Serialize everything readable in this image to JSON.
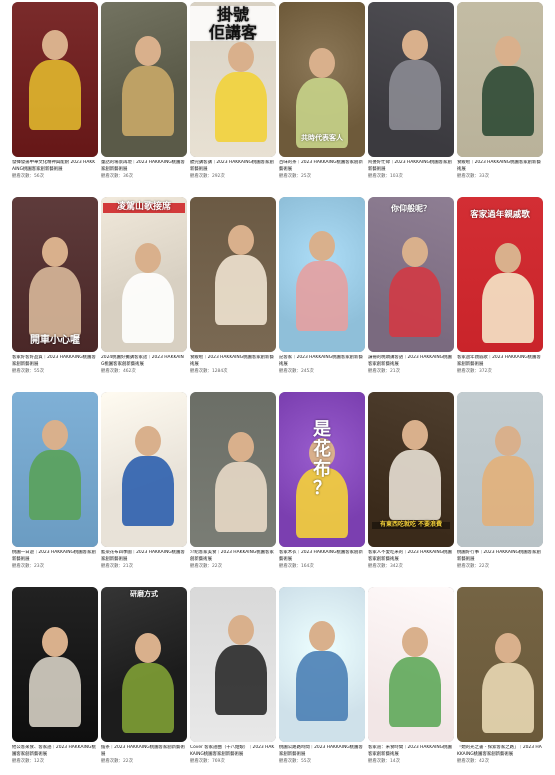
{
  "views_prefix": "觀看次數：",
  "views_suffix": "次",
  "videos": [
    {
      "title": "發揮發揚中華文化精神與能耐 2023 HAKKAING桃園客家創新藝術展",
      "views": "56",
      "overlay": "",
      "bg": "#7a2b2b",
      "accent": "#e0b72d"
    },
    {
      "title": "童話的場景再現｜2023 HAKKAING桃園客家創新藝術展",
      "views": "36",
      "overlay": "",
      "bg": "#5a5a48",
      "accent": "#c9a868"
    },
    {
      "title": "聽完講客講｜2023 HAKKAING桃園客家創新藝術展",
      "views": "292",
      "overlay": "掛號\n佢講客",
      "bg": "#d9d2c4",
      "accent": "#f2d23a"
    },
    {
      "title": "百味的茶｜2023 HAKKAING桃園客家創新藝術展",
      "views": "25",
      "overlay": "共時代表客人",
      "bg": "#6e5a3a",
      "accent": "#c8d48a"
    },
    {
      "title": "阿婆好忙碌｜2023 HAKKAING桃園客家創新藝術展",
      "views": "103",
      "overlay": "",
      "bg": "#3b3a3f",
      "accent": "#8b8b92"
    },
    {
      "title": "食飯啦｜2023 HAKKAING桃園客家創新藝術展",
      "views": "33",
      "overlay": "",
      "bg": "#b9b29a",
      "accent": "#2f4a35"
    },
    {
      "title": "客家好客好品質｜2023 HAKKAING桃園客家創新藝術展",
      "views": "55",
      "overlay": "開車小心喔",
      "bg": "#5e3b3b",
      "accent": "#d8b89a"
    },
    {
      "title": "2024桃園好攤講客家話｜2023 HAKKAING桃園客家創新藝術展",
      "views": "462",
      "overlay": "凌駕山歌接席",
      "bg": "#d8d0c2",
      "accent": "#ffffff"
    },
    {
      "title": "食飯啦｜2023 HAKKAING桃園客家創新藝術展",
      "views": "1284",
      "overlay": "",
      "bg": "#6b5a44",
      "accent": "#efe3d0"
    },
    {
      "title": "記客家｜2023 HAKKAING桃園客家創新藝術展",
      "views": "245",
      "overlay": "",
      "bg": "#8fbfd9",
      "accent": "#e6a0a0"
    },
    {
      "title": "讀冊的晚頭講客語｜2023 HAKKAING桃園客家創新藝術展",
      "views": "21",
      "overlay": "你仰般呢？",
      "bg": "#7a6a7f",
      "accent": "#d23a45"
    },
    {
      "title": "客家過年親戚歌｜2023 HAKKAING桃園客家創新藝術展",
      "views": "372",
      "overlay": "客家過年親戚歌",
      "bg": "#c9242a",
      "accent": "#f5e6c8"
    },
    {
      "title": "桃園一日遊｜2023 HAKKAING桃園客家創新藝術展",
      "views": "23",
      "overlay": "",
      "bg": "#7fb0d6",
      "accent": "#5aa25a"
    },
    {
      "title": "藍染花布四季圖｜2023 HAKKAING桃園客家創新藝術展",
      "views": "21",
      "overlay": "",
      "bg": "#e8e2d8",
      "accent": "#2c5fae"
    },
    {
      "title": "介紹客家美食｜2023 HAKKAING桃園客家創新藝術展",
      "views": "22",
      "overlay": "",
      "bg": "#6b6e66",
      "accent": "#e8d9c7"
    },
    {
      "title": "客家木衣｜2023 HAKKAING桃園客家創新藝術展",
      "views": "164",
      "overlay": "是\n花\n布\n？",
      "bg": "#7b3fb0",
      "accent": "#f5d23a"
    },
    {
      "title": "客家人不愛吃米的｜2023 HAKKAING桃園客家創新藝術展",
      "views": "342",
      "overlay": "有東西吃就吃 不要浪費",
      "bg": "#3a2a1a",
      "accent": "#e8e0d4"
    },
    {
      "title": "桃園好行事｜2023 HAKKAING桃園客家創新藝術展",
      "views": "22",
      "overlay": "",
      "bg": "#b8c2c6",
      "accent": "#e2b07a"
    },
    {
      "title": "他公客來食、客家語｜2023 HAKKAING桃園客家創新藝術展",
      "views": "12",
      "overlay": "",
      "bg": "#222222",
      "accent": "#d6d0c4"
    },
    {
      "title": "擂茶｜2023 HAKKAING桃園客家創新藝術展",
      "views": "22",
      "overlay": "研磨方式",
      "bg": "#1c1c1c",
      "accent": "#7fa035"
    },
    {
      "title": "Cover 客家語曲（十八姑娘）｜2023 HAKKAING桃園客家創新藝術展",
      "views": "769",
      "overlay": "",
      "bg": "#d9d9d9",
      "accent": "#2a2a2a"
    },
    {
      "title": "桃園公路路時間｜2023 HAKKAING桃園客家創新藝術展",
      "views": "55",
      "overlay": "",
      "bg": "#cfe1ea",
      "accent": "#4a7fb5"
    },
    {
      "title": "客家道：米食時間｜2023 HAKKAING桃園客家創新藝術展",
      "views": "14",
      "overlay": "",
      "bg": "#f2e6e6",
      "accent": "#5fa85a"
    },
    {
      "title": "「她的光之書 - 探索客家之路」｜2023 HAKKAING桃園客家創新藝術展",
      "views": "42",
      "overlay": "",
      "bg": "#6b5a3a",
      "accent": "#e9d8b4"
    }
  ]
}
